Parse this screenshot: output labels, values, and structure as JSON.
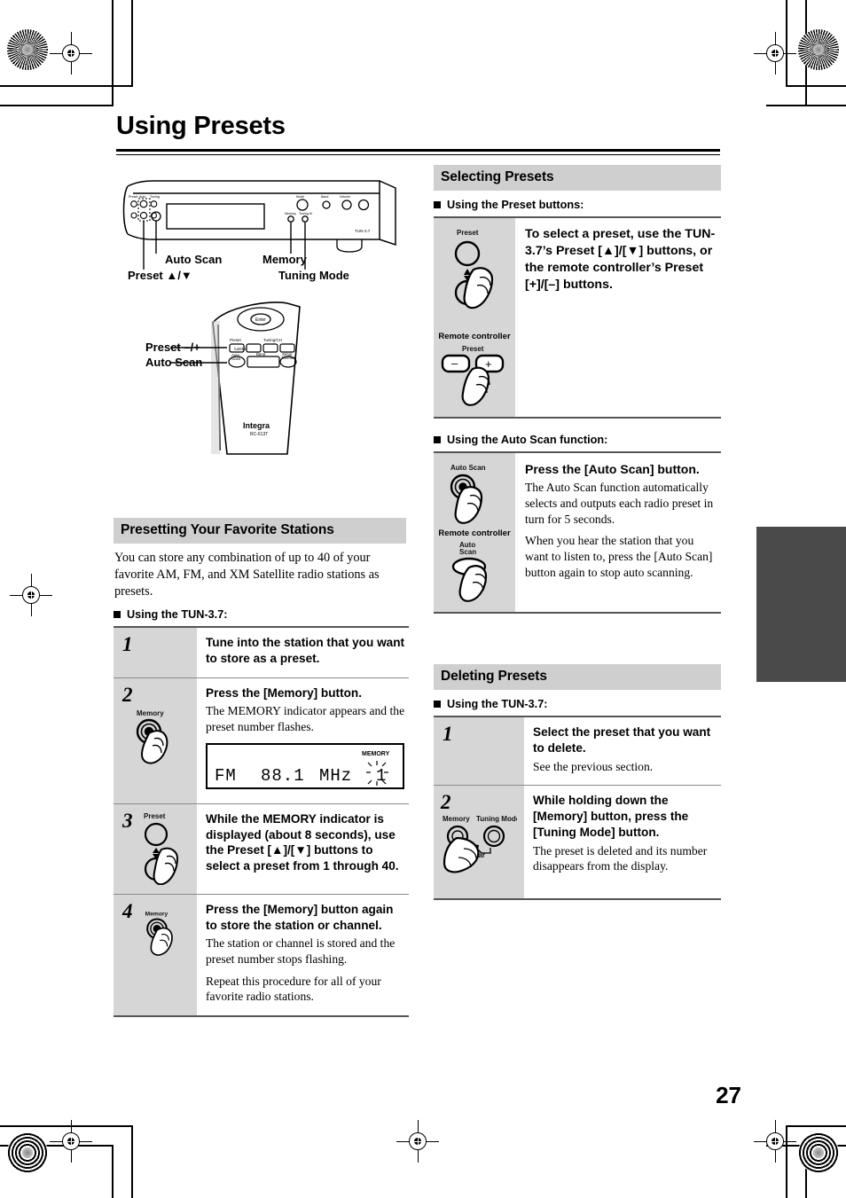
{
  "page": {
    "title": "Using Presets",
    "number": "27"
  },
  "front_panel": {
    "caption_auto_scan": "Auto Scan",
    "caption_preset": "Preset ▲/▼",
    "caption_memory": "Memory",
    "caption_tuning_mode": "Tuning Mode",
    "model_mark": "TUN-3.7"
  },
  "remote_diagram": {
    "caption_preset": "Preset –/+",
    "caption_auto_scan": "Auto Scan",
    "brand": "Integra",
    "model": "RC-613T",
    "key_preset": "Preset",
    "key_tuning": "Tuning/CH",
    "key_auto_scan": "Auto Scan",
    "key_band": "Band",
    "key_setup": "Setup Memory",
    "key_enter": "Enter"
  },
  "presetting": {
    "heading": "Presetting Your Favorite Stations",
    "intro": "You can store any combination of up to 40 of your favorite AM, FM, and XM Satellite radio stations as presets.",
    "subhead": "Using the TUN-3.7:",
    "steps": [
      {
        "number": "1",
        "lead": "Tune into the station that you want to store as a preset.",
        "notes": [],
        "icon": ""
      },
      {
        "number": "2",
        "lead": "Press the [Memory] button.",
        "notes": [
          "The MEMORY indicator appears and the preset number flashes."
        ],
        "icon": "memory-button-press-icon",
        "icon_label": "Memory",
        "display": {
          "band": "FM",
          "frequency": "88.1",
          "unit": "MHz",
          "memory_indicator": "MEMORY",
          "preset_number": "1"
        }
      },
      {
        "number": "3",
        "lead": "While the MEMORY indicator is displayed (about 8 seconds), use the Preset [▲]/[▼] buttons to select a preset from 1 through 40.",
        "notes": [],
        "icon": "preset-up-down-press-icon",
        "icon_label": "Preset"
      },
      {
        "number": "4",
        "lead": "Press the [Memory] button again to store the station or channel.",
        "notes": [
          "The station or channel is stored and the preset number stops flashing.",
          "Repeat this procedure for all of your favorite radio stations."
        ],
        "icon": "memory-button-press-icon",
        "icon_label": "Memory"
      }
    ]
  },
  "selecting": {
    "heading": "Selecting Presets",
    "preset_buttons": {
      "subhead": "Using the Preset buttons:",
      "icon_label_preset": "Preset",
      "remote_label": "Remote controller",
      "remote_key_label": "Preset",
      "remote_minus": "–",
      "remote_plus": "+",
      "lead": "To select a preset, use the TUN-3.7’s Preset [▲]/[▼] buttons, or the remote controller’s Preset [+]/[–] buttons."
    },
    "auto_scan": {
      "subhead": "Using the Auto Scan function:",
      "icon_label": "Auto Scan",
      "remote_label": "Remote controller",
      "remote_key_label": "Auto Scan",
      "lead": "Press the [Auto Scan] button.",
      "notes": [
        "The Auto Scan function automatically selects and outputs each radio preset in turn for 5 seconds.",
        "When you hear the station that you want to listen to, press the [Auto Scan] button again to stop auto scanning."
      ]
    }
  },
  "deleting": {
    "heading": "Deleting Presets",
    "subhead": "Using the TUN-3.7:",
    "steps": [
      {
        "number": "1",
        "lead": "Select the preset that you want to delete.",
        "notes": [
          "See the previous section."
        ],
        "icon": ""
      },
      {
        "number": "2",
        "lead": "While holding down the [Memory] button, press the [Tuning Mode] button.",
        "notes": [
          "The preset is deleted and its number disappears from the display."
        ],
        "icon": "memory-plus-tuning-mode-press-icon",
        "icon_label_memory": "Memory",
        "icon_label_tuning": "Tuning Mode",
        "icon_label_clear": "Clear"
      }
    ]
  },
  "colors": {
    "section_bar": "#cfcfcf",
    "cell_gray": "#d6d6d6",
    "tab_gray": "#4a4a4a",
    "rule": "#555555"
  }
}
